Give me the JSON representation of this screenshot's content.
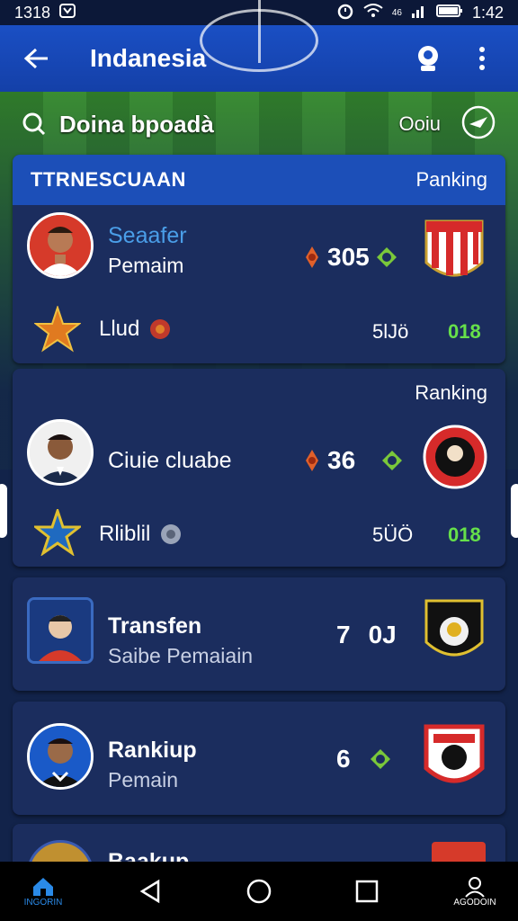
{
  "status": {
    "left_time": "1318",
    "right_time": "1:42",
    "signal": "46"
  },
  "app_bar": {
    "title": "Indanesia"
  },
  "search": {
    "text": "Doina bpoadà",
    "right_text": "Ooiu"
  },
  "cards": [
    {
      "header_title": "TTRNESCUAAN",
      "header_ranking": "Panking",
      "name": "Seaafer",
      "sub": "Pemaim",
      "score": "305",
      "lower_label": "Llud",
      "lower_num1": "5lJö",
      "lower_num2": "018"
    },
    {
      "ranking": "Ranking",
      "name": "Ciuie cluabe",
      "score": "36",
      "lower_label": "Rliblil",
      "lower_num1": "5ÜÖ",
      "lower_num2": "018"
    },
    {
      "name": "Transfen",
      "sub": "Saibe Pemaiain",
      "score_a": "7",
      "score_b": "0J"
    },
    {
      "name": "Rankiup",
      "sub": "Pemain",
      "score": "6"
    },
    {
      "name": "Baakup"
    }
  ],
  "nav": {
    "home_label": "INGORIN",
    "account_label": "AGODOIN"
  },
  "colors": {
    "app_bar": "#1a4fc4",
    "card": "#1b2d5e",
    "accent_green": "#66e04a"
  }
}
